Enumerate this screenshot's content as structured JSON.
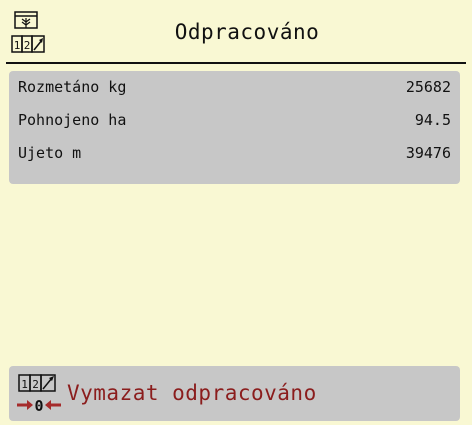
{
  "header": {
    "title": "Odpracováno",
    "icon": "work-counter-icon"
  },
  "stats": [
    {
      "label": "Rozmetáno kg",
      "value": "25682"
    },
    {
      "label": "Pohnojeno ha",
      "value": "94.5"
    },
    {
      "label": "Ujeto m",
      "value": "39476"
    }
  ],
  "footer": {
    "label": "Vymazat odpracováno",
    "icon": "reset-counter-icon"
  },
  "colors": {
    "background": "#f9f8d3",
    "panel": "#c7c7c7",
    "accent": "#8b1d1d"
  }
}
